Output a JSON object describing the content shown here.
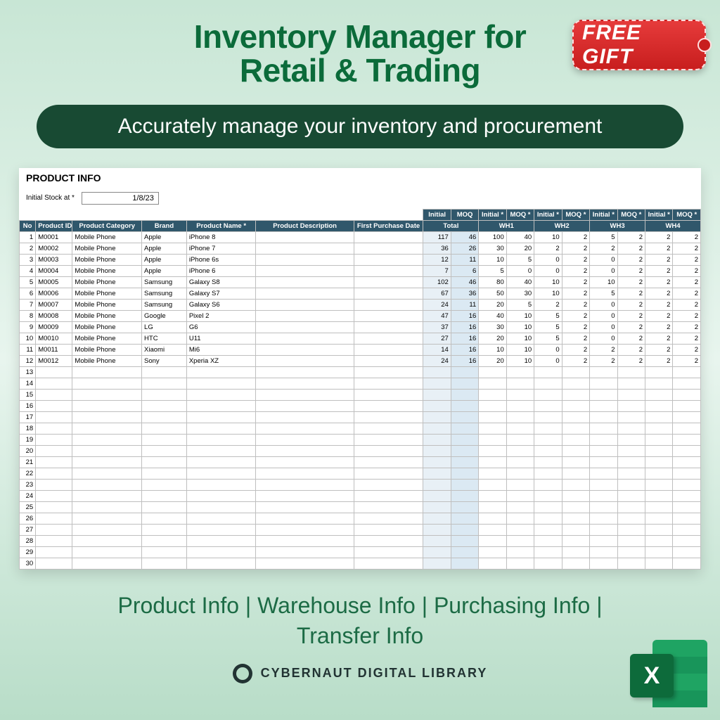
{
  "header": {
    "title_line1": "Inventory Manager for",
    "title_line2": "Retail & Trading",
    "gift_label": "FREE GIFT",
    "subtitle": "Accurately manage your inventory and procurement"
  },
  "sheet": {
    "title": "PRODUCT INFO",
    "initial_label": "Initial Stock at *",
    "initial_date": "1/8/23",
    "group_headers": [
      "Initial",
      "MOQ",
      "Initial *",
      "MOQ *",
      "Initial *",
      "MOQ *",
      "Initial *",
      "MOQ *",
      "Initial *",
      "MOQ *"
    ],
    "wh_headers": [
      "Total",
      "WH1",
      "WH2",
      "WH3",
      "WH4"
    ],
    "col_headers": [
      "No",
      "Product ID *",
      "Product Category",
      "Brand",
      "Product Name *",
      "Product Description",
      "First Purchase Date"
    ],
    "rows": [
      {
        "no": 1,
        "id": "M0001",
        "cat": "Mobile Phone",
        "brand": "Apple",
        "name": "iPhone 8",
        "v": [
          117,
          46,
          100,
          40,
          10,
          2,
          5,
          2,
          2,
          2
        ]
      },
      {
        "no": 2,
        "id": "M0002",
        "cat": "Mobile Phone",
        "brand": "Apple",
        "name": "iPhone 7",
        "v": [
          36,
          26,
          30,
          20,
          2,
          2,
          2,
          2,
          2,
          2
        ]
      },
      {
        "no": 3,
        "id": "M0003",
        "cat": "Mobile Phone",
        "brand": "Apple",
        "name": "iPhone 6s",
        "v": [
          12,
          11,
          10,
          5,
          0,
          2,
          0,
          2,
          2,
          2
        ]
      },
      {
        "no": 4,
        "id": "M0004",
        "cat": "Mobile Phone",
        "brand": "Apple",
        "name": "iPhone 6",
        "v": [
          7,
          6,
          5,
          0,
          0,
          2,
          0,
          2,
          2,
          2
        ]
      },
      {
        "no": 5,
        "id": "M0005",
        "cat": "Mobile Phone",
        "brand": "Samsung",
        "name": "Galaxy S8",
        "v": [
          102,
          46,
          80,
          40,
          10,
          2,
          10,
          2,
          2,
          2
        ]
      },
      {
        "no": 6,
        "id": "M0006",
        "cat": "Mobile Phone",
        "brand": "Samsung",
        "name": "Galaxy S7",
        "v": [
          67,
          36,
          50,
          30,
          10,
          2,
          5,
          2,
          2,
          2
        ]
      },
      {
        "no": 7,
        "id": "M0007",
        "cat": "Mobile Phone",
        "brand": "Samsung",
        "name": "Galaxy S6",
        "v": [
          24,
          11,
          20,
          5,
          2,
          2,
          0,
          2,
          2,
          2
        ]
      },
      {
        "no": 8,
        "id": "M0008",
        "cat": "Mobile Phone",
        "brand": "Google",
        "name": "Pixel 2",
        "v": [
          47,
          16,
          40,
          10,
          5,
          2,
          0,
          2,
          2,
          2
        ]
      },
      {
        "no": 9,
        "id": "M0009",
        "cat": "Mobile Phone",
        "brand": "LG",
        "name": "G6",
        "v": [
          37,
          16,
          30,
          10,
          5,
          2,
          0,
          2,
          2,
          2
        ]
      },
      {
        "no": 10,
        "id": "M0010",
        "cat": "Mobile Phone",
        "brand": "HTC",
        "name": "U11",
        "v": [
          27,
          16,
          20,
          10,
          5,
          2,
          0,
          2,
          2,
          2
        ]
      },
      {
        "no": 11,
        "id": "M0011",
        "cat": "Mobile Phone",
        "brand": "Xiaomi",
        "name": "Mi6",
        "v": [
          14,
          16,
          10,
          10,
          0,
          2,
          2,
          2,
          2,
          2
        ]
      },
      {
        "no": 12,
        "id": "M0012",
        "cat": "Mobile Phone",
        "brand": "Sony",
        "name": "Xperia XZ",
        "v": [
          24,
          16,
          20,
          10,
          0,
          2,
          2,
          2,
          2,
          2
        ]
      }
    ],
    "empty_from": 13,
    "empty_to": 30
  },
  "features": {
    "line1": "Product Info | Warehouse Info | Purchasing Info |",
    "line2": "Transfer Info"
  },
  "brand": {
    "name": "CYBERNAUT DIGITAL LIBRARY"
  },
  "excel": {
    "letter": "X"
  }
}
